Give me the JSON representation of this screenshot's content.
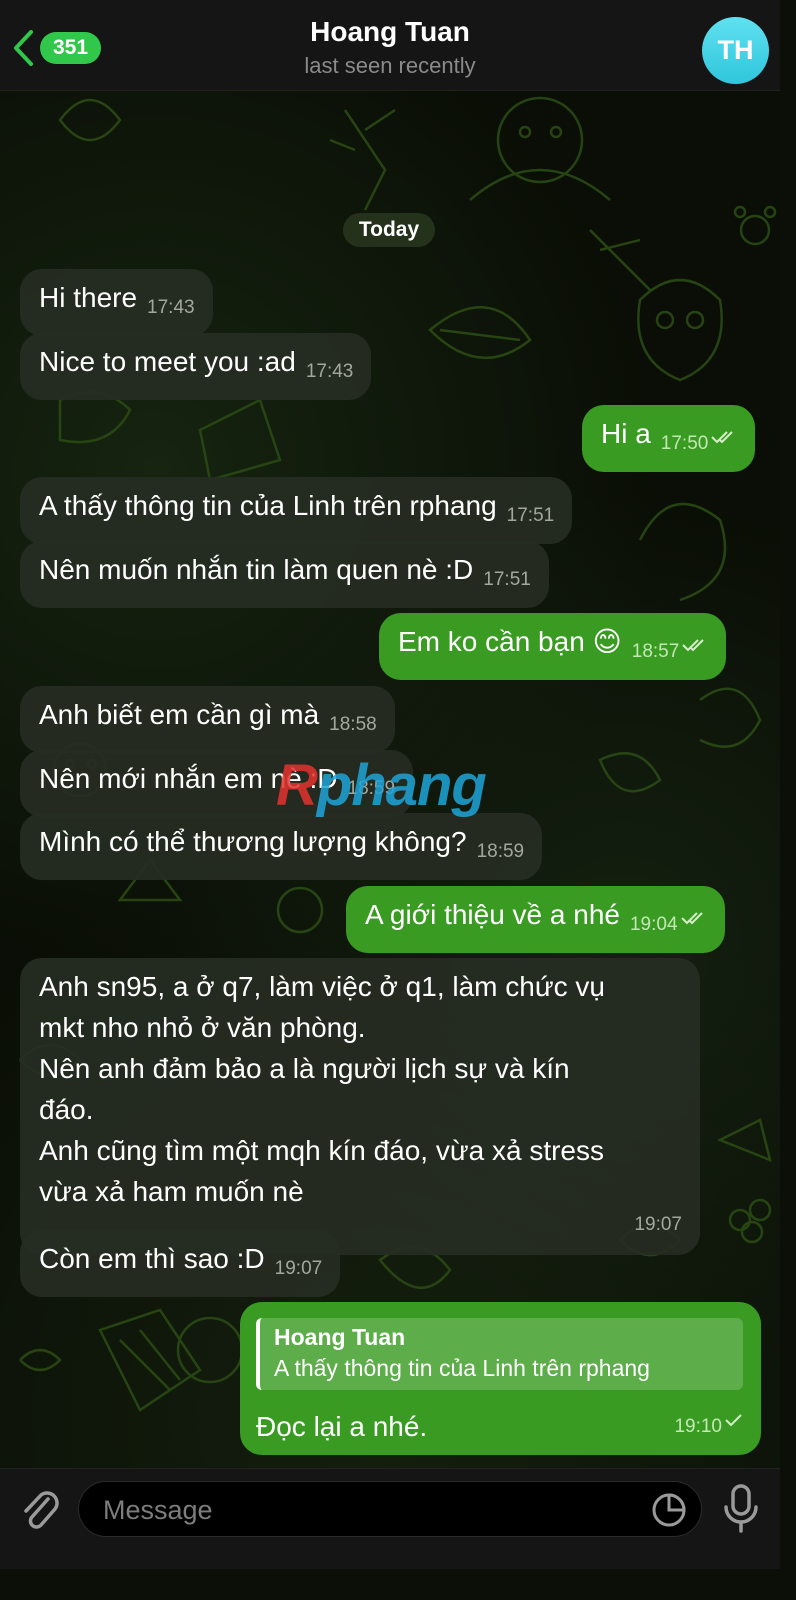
{
  "header": {
    "back_count": "351",
    "title": "Hoang Tuan",
    "subtitle": "last seen recently",
    "avatar_initials": "TH"
  },
  "date_chip": "Today",
  "messages": [
    {
      "dir": "in",
      "text": "Hi there",
      "time": "17:43"
    },
    {
      "dir": "in",
      "text": "Nice to meet you :ad",
      "time": "17:43"
    },
    {
      "dir": "out",
      "text": "Hi a",
      "time": "17:50",
      "status": "read"
    },
    {
      "dir": "in",
      "text": "A thấy thông tin của Linh trên rphang",
      "time": "17:51"
    },
    {
      "dir": "in",
      "text": "Nên muốn nhắn tin làm quen nè :D",
      "time": "17:51"
    },
    {
      "dir": "out",
      "text": "Em ko cần bạn 😊",
      "time": "18:57",
      "status": "read"
    },
    {
      "dir": "in",
      "text": "Anh biết em cần gì mà",
      "time": "18:58"
    },
    {
      "dir": "in",
      "text": "Nên mới nhắn em nè :D",
      "time": "18:59"
    },
    {
      "dir": "in",
      "text": "Mình có thể thương lượng không?",
      "time": "18:59"
    },
    {
      "dir": "out",
      "text": "A giới thiệu về a nhé",
      "time": "19:04",
      "status": "read"
    },
    {
      "dir": "in",
      "lines": [
        "Anh sn95, a ở q7, làm việc ở q1, làm chức vụ",
        "mkt nho nhỏ ở văn phòng.",
        "Nên anh đảm bảo a là người lịch sự và kín",
        "đáo.",
        "Anh cũng tìm một mqh kín đáo, vừa xả stress",
        "vừa xả ham muốn nè"
      ],
      "time": "19:07"
    },
    {
      "dir": "in",
      "text": "Còn em thì sao :D",
      "time": "19:07"
    },
    {
      "dir": "out",
      "reply_to": {
        "author": "Hoang Tuan",
        "text": "A thấy thông tin của Linh trên rphang"
      },
      "text": "Đọc lại a nhé.",
      "time": "19:10",
      "status": "sent"
    }
  ],
  "watermark": {
    "r": "R",
    "rest": "phang"
  },
  "input": {
    "placeholder": "Message"
  },
  "icons": {
    "back": "chevron-left-icon",
    "attach": "paperclip-icon",
    "sticker": "sticker-icon",
    "mic": "microphone-icon",
    "read": "double-check-icon",
    "sent": "single-check-icon"
  },
  "colors": {
    "accent": "#30c74a",
    "outgoing_bubble": "#3a9b23",
    "incoming_bubble": "#262c22",
    "avatar": "#3fd1e5"
  }
}
